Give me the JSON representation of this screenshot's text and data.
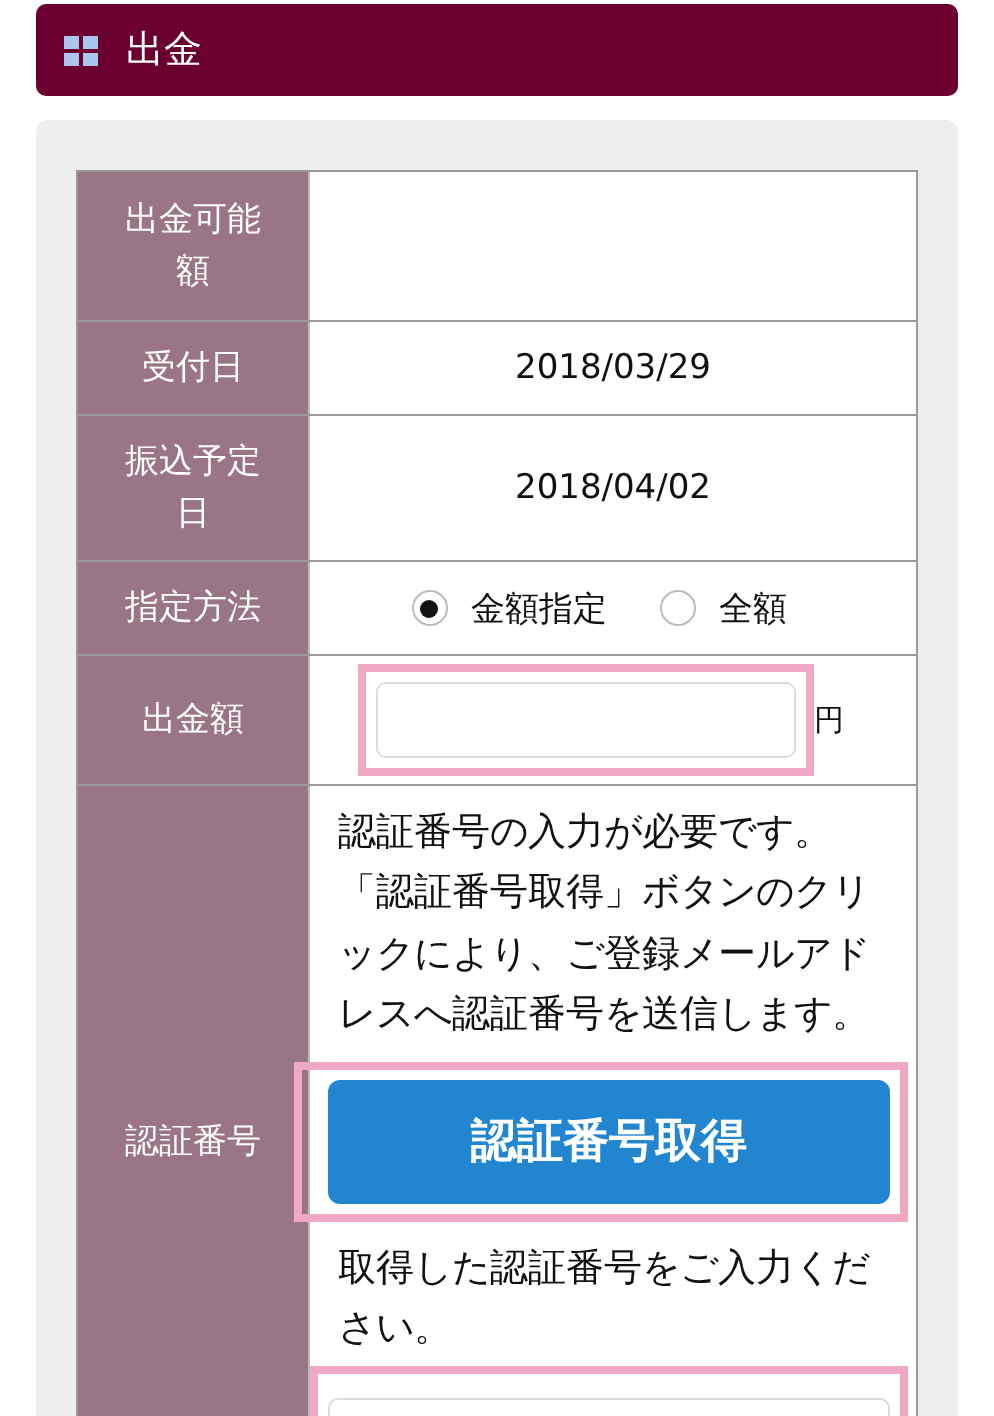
{
  "header": {
    "title": "出金"
  },
  "rows": [
    {
      "label": "出金可能額",
      "kind": "empty"
    },
    {
      "label": "受付日",
      "kind": "text",
      "value": "2018/03/29"
    },
    {
      "label": "振込予定日",
      "kind": "text",
      "value": "2018/04/02"
    },
    {
      "label": "指定方法",
      "kind": "radio",
      "options": [
        {
          "label": "金額指定",
          "selected": true
        },
        {
          "label": "全額",
          "selected": false
        }
      ]
    },
    {
      "label": "出金額",
      "kind": "amount",
      "unit": "円",
      "highlighted": true
    },
    {
      "label": "認証番号",
      "kind": "auth",
      "notice": "認証番号の入力が必要です。「認証番号取得」ボタンのクリックにより、ご登録メールアドレスへ認証番号を送信します。",
      "button": "認証番号取得",
      "button_highlighted": true,
      "instruction": "取得した認証番号をご入力ください。",
      "input_highlighted": true
    }
  ]
}
